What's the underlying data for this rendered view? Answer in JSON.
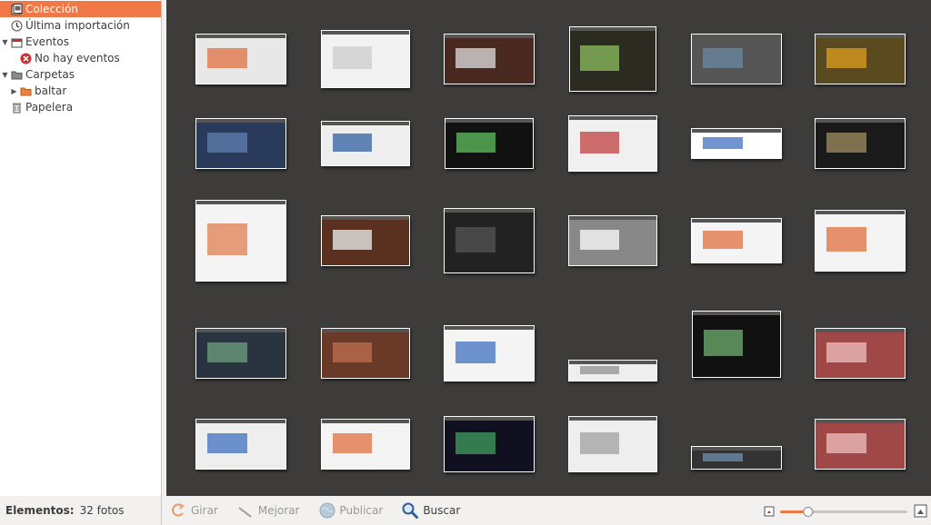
{
  "sidebar": {
    "items": [
      {
        "label": "Colección",
        "icon": "library-icon",
        "selected": true
      },
      {
        "label": "Última importación",
        "icon": "clock-icon"
      },
      {
        "label": "Eventos",
        "icon": "events-icon",
        "expander": "expanded"
      },
      {
        "label": "No hay eventos",
        "icon": "error-icon"
      },
      {
        "label": "Carpetas",
        "icon": "folder-icon",
        "expander": "expanded"
      },
      {
        "label": "baltar",
        "icon": "folder-icon",
        "expander": "collapsed"
      },
      {
        "label": "Papelera",
        "icon": "trash-icon"
      }
    ]
  },
  "status": {
    "label": "Elementos:",
    "value": "32 fotos"
  },
  "toolbar": {
    "rotate_label": "Girar",
    "enhance_label": "Mejorar",
    "publish_label": "Publicar",
    "search_label": "Buscar"
  },
  "zoom": {
    "level": 0.22
  },
  "thumbnails": [
    {
      "color": "#e8e8e8",
      "accent": "#e07040"
    },
    {
      "color": "#f2f2f2",
      "accent": "#cccccc"
    },
    {
      "color": "#4a2a20",
      "accent": "#e0e0e0"
    },
    {
      "color": "#2b2b22",
      "accent": "#8ec060"
    },
    {
      "color": "#555555",
      "accent": "#6a8aa0"
    },
    {
      "color": "#5a4a20",
      "accent": "#e0a020"
    },
    {
      "color": "#2a3a5a",
      "accent": "#6080b0"
    },
    {
      "color": "#eeeeee",
      "accent": "#3060a0"
    },
    {
      "color": "#111111",
      "accent": "#60c060"
    },
    {
      "color": "#f0f0f0",
      "accent": "#c04040"
    },
    {
      "color": "#ffffff",
      "accent": "#4070c0"
    },
    {
      "color": "#1a1a1a",
      "accent": "#a09060"
    },
    {
      "color": "#f4f4f4",
      "accent": "#e08050"
    },
    {
      "color": "#5a3020",
      "accent": "#f0f0f0"
    },
    {
      "color": "#222222",
      "accent": "#555555"
    },
    {
      "color": "#888888",
      "accent": "#ffffff"
    },
    {
      "color": "#f4f4f4",
      "accent": "#e07040"
    },
    {
      "color": "#f4f4f4",
      "accent": "#e07040"
    },
    {
      "color": "#2a3440",
      "accent": "#70a080"
    },
    {
      "color": "#6a3a28",
      "accent": "#c07050"
    },
    {
      "color": "#f4f4f4",
      "accent": "#4070c0"
    },
    {
      "color": "#eeeeee",
      "accent": "#909090"
    },
    {
      "color": "#111111",
      "accent": "#70b070"
    },
    {
      "color": "#a04848",
      "accent": "#f0c0c0"
    },
    {
      "color": "#eeeeee",
      "accent": "#4070c0"
    },
    {
      "color": "#f4f4f4",
      "accent": "#e07040"
    },
    {
      "color": "#101020",
      "accent": "#40a060"
    },
    {
      "color": "#eeeeee",
      "accent": "#a0a0a0"
    },
    {
      "color": "#333333",
      "accent": "#7090b0"
    },
    {
      "color": "#a04848",
      "accent": "#f0c0c0"
    }
  ]
}
